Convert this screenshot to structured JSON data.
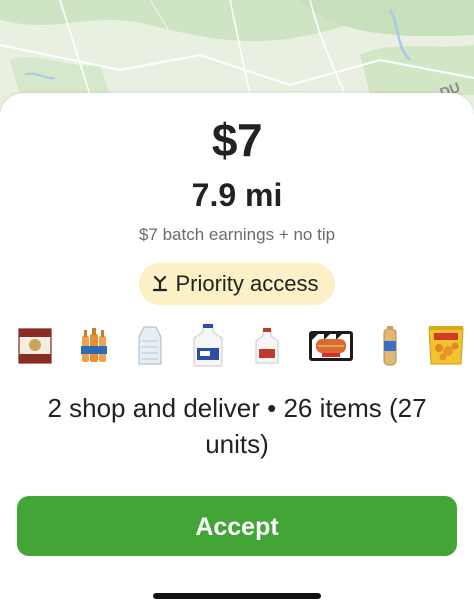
{
  "map": {
    "corner_label": "DU"
  },
  "offer": {
    "amount": "$7",
    "distance": "7.9 mi",
    "earnings_note": "$7 batch earnings + no tip",
    "badge_label": "Priority access",
    "summary": "2 shop and deliver • 26 items (27 units)",
    "accept_label": "Accept"
  },
  "items": [
    {
      "icon": "beer-case-icon"
    },
    {
      "icon": "soda-bottles-icon"
    },
    {
      "icon": "ice-bag-icon"
    },
    {
      "icon": "milk-gallon-icon"
    },
    {
      "icon": "milk-half-gallon-icon"
    },
    {
      "icon": "hot-dog-buns-icon"
    },
    {
      "icon": "bread-loaf-icon"
    },
    {
      "icon": "chips-bag-icon"
    }
  ],
  "colors": {
    "accept": "#43a536",
    "badge_bg": "#fbf0c6"
  }
}
